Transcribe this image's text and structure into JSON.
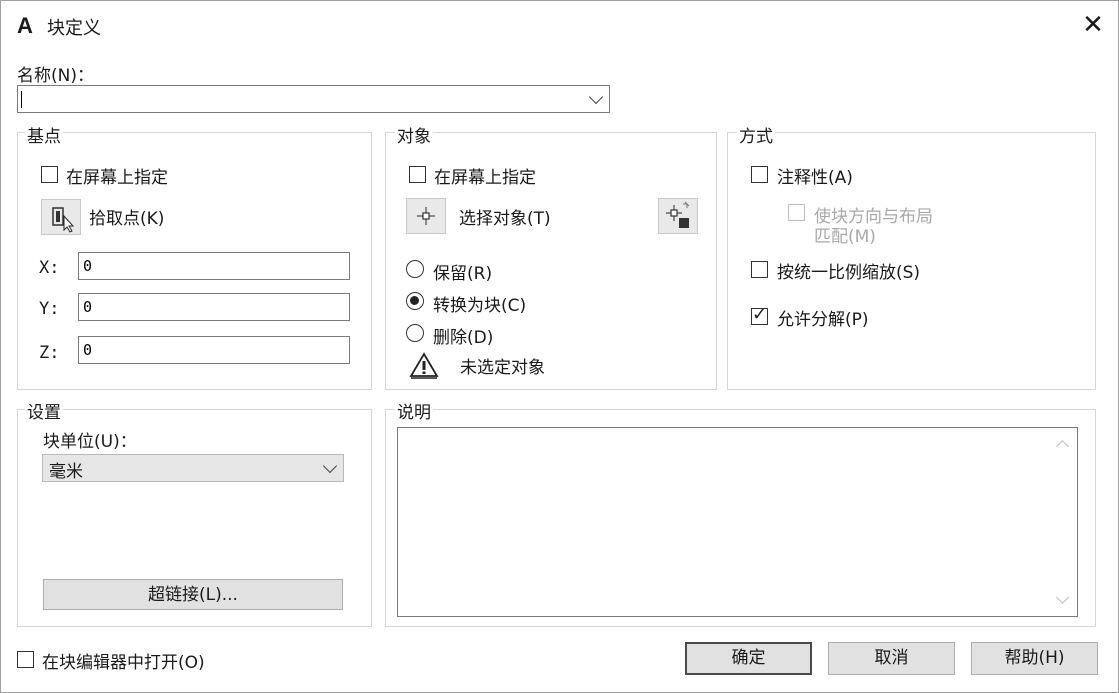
{
  "window": {
    "title": "块定义",
    "logo": "A",
    "close": "✕"
  },
  "name": {
    "label": "名称(N)：",
    "value": ""
  },
  "basepoint": {
    "title": "基点",
    "specify_on_screen": "在屏幕上指定",
    "pick_point": "拾取点(K)",
    "x_label": "X:",
    "x_value": "0",
    "y_label": "Y:",
    "y_value": "0",
    "z_label": "Z:",
    "z_value": "0"
  },
  "objects": {
    "title": "对象",
    "specify_on_screen": "在屏幕上指定",
    "select_objects": "选择对象(T)",
    "retain": "保留(R)",
    "convert_to_block": "转换为块(C)",
    "delete": "删除(D)",
    "status": "未选定对象",
    "selected_option": "convert_to_block"
  },
  "behavior": {
    "title": "方式",
    "annotative": "注释性(A)",
    "match_orientation_line1": "使块方向与布局",
    "match_orientation_line2": "匹配(M)",
    "scale_uniformly": "按统一比例缩放(S)",
    "allow_exploding": "允许分解(P)",
    "allow_exploding_checked": true
  },
  "settings": {
    "title": "设置",
    "block_unit_label": "块单位(U)：",
    "block_unit_value": "毫米",
    "hyperlink": "超链接(L)..."
  },
  "description": {
    "title": "说明",
    "value": ""
  },
  "footer": {
    "open_in_editor": "在块编辑器中打开(O)",
    "ok": "确定",
    "cancel": "取消",
    "help": "帮助(H)"
  }
}
